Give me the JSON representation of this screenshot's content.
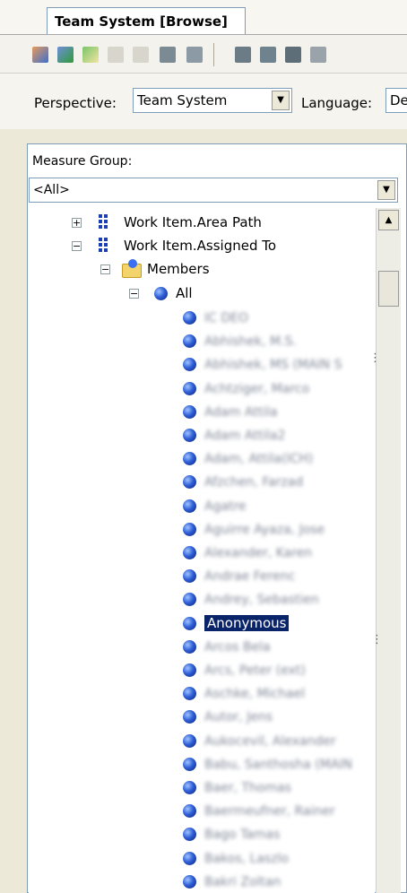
{
  "window": {
    "tab_title": "Team System [Browse]"
  },
  "toolbar": {
    "icons": [
      "users-icon",
      "cube-icon",
      "refresh-icon",
      "sort-asc-icon",
      "sort-desc-icon",
      "filter-icon",
      "filter-dropdown-icon",
      "grid-icon",
      "table-icon",
      "funnel-icon",
      "eraser-icon"
    ]
  },
  "perspective": {
    "label": "Perspective:",
    "value": "Team System",
    "language_label": "Language:",
    "language_value": "De"
  },
  "measure_group": {
    "label": "Measure Group:",
    "value": "<All>"
  },
  "tree": {
    "area_path": "Work Item.Area Path",
    "assigned_to": "Work Item.Assigned To",
    "members": "Members",
    "all": "All",
    "selected_member": "Anonymous",
    "blurred_members": [
      "IC DEO",
      "Abhishek, M.S.",
      "Abhishek, MS (MAIN S",
      "Achtziger, Marco",
      "Adam Attila",
      "Adam Attila2",
      "Adam, Attila(ICH)",
      "Afzchen, Farzad",
      "Agatre",
      "Aguirre Ayaza, Jose",
      "Alexander, Karen",
      "Andrae Ferenc",
      "Andrey, Sebastien",
      "Anonymous",
      "Arcos Bela",
      "Arcs, Peter (ext)",
      "Aschke, Michael",
      "Autor, Jens",
      "Aukocevil, Alexander",
      "Babu, Santhosha (MAIN",
      "Baer, Thomas",
      "Baermeufner, Rainer",
      "Bago Tamas",
      "Bakos, Laszlo",
      "Bakri Zoltan"
    ]
  },
  "colors": {
    "selection": "#0a246a",
    "sphere": "#2f5fd7"
  }
}
